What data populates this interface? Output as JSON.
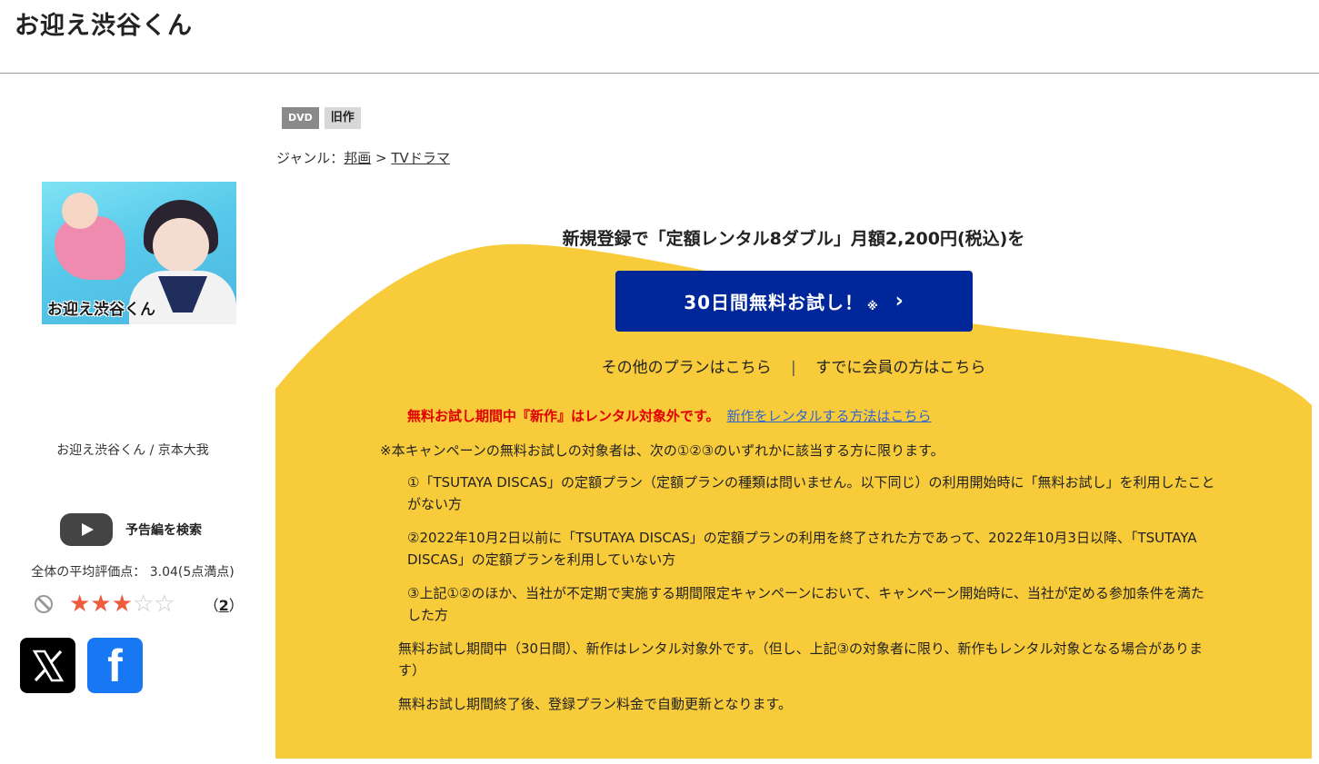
{
  "page": {
    "title": "お迎え渋谷くん"
  },
  "item": {
    "cover_alt": "お迎え渋谷くん",
    "caption": "お迎え渋谷くん / 京本大我",
    "trailer_label": "予告編を検索",
    "avg_rating_text": "全体の平均評価点： 3.04(5点満点)",
    "rating": {
      "value": 3.04,
      "max": 5
    },
    "review_count": "2",
    "stars": "★★★",
    "stars_empty": "☆☆",
    "paren_open": "（",
    "paren_close": "）"
  },
  "social": {
    "x_icon": "x-logo-icon",
    "facebook_icon": "facebook-logo-icon",
    "facebook_glyph": "f"
  },
  "badges": {
    "format": "DVD",
    "status": "旧作"
  },
  "genre": {
    "label": "ジャンル：",
    "items": [
      "邦画",
      "TVドラマ"
    ],
    "separator": " > "
  },
  "campaign": {
    "headline": "新規登録で「定額レンタル8ダブル」月額2,200円(税込)を",
    "cta_label": "30日間無料お試し！",
    "cta_note_mark": "※",
    "cta_chevron": "›",
    "other_plans": "その他のプランはこちら",
    "link_separator": "|",
    "members_link": "すでに会員の方はこちら",
    "warning": "無料お試し期間中『新作』はレンタル対象外です。",
    "warning_link": "新作をレンタルする方法はこちら",
    "notes_head": "※本キャンペーンの無料お試しの対象者は、次の①②③のいずれかに該当する方に限ります。",
    "notes_items": [
      "①「TSUTAYA DISCAS」の定額プラン（定額プランの種類は問いません。以下同じ）の利用開始時に「無料お試し」を利用したことがない方",
      "②2022年10月2日以前に「TSUTAYA DISCAS」の定額プランの利用を終了された方であって、2022年10月3日以降、「TSUTAYA DISCAS」の定額プランを利用していない方",
      "③上記①②のほか、当社が不定期で実施する期間限定キャンペーンにおいて、キャンペーン開始時に、当社が定める参加条件を満たした方"
    ],
    "notes_para1": "無料お試し期間中（30日間）、新作はレンタル対象外です。（但し、上記③の対象者に限り、新作もレンタル対象となる場合があります）",
    "notes_para2": "無料お試し期間終了後、登録プラン料金で自動更新となります。"
  },
  "colors": {
    "accent_blue": "#00279a",
    "promo_yellow": "#f8cb3a",
    "warning_red": "#e10000",
    "star": "#ee5b3f"
  }
}
